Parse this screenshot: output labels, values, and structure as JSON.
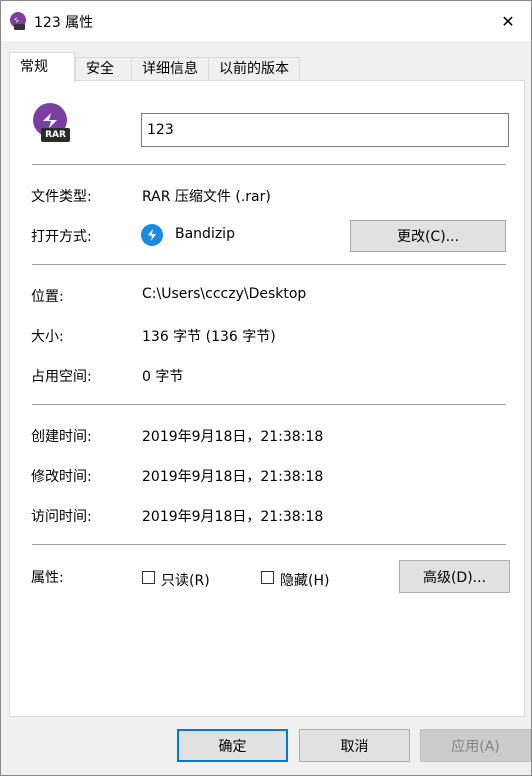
{
  "window": {
    "title": "123 属性",
    "close_glyph": "✕"
  },
  "tabs": [
    {
      "label": "常规",
      "active": true
    },
    {
      "label": "安全",
      "active": false
    },
    {
      "label": "详细信息",
      "active": false
    },
    {
      "label": "以前的版本",
      "active": false
    }
  ],
  "file": {
    "icon_text": "RAR",
    "name": "123"
  },
  "type": {
    "label": "文件类型:",
    "value": "RAR 压缩文件 (.rar)"
  },
  "opens_with": {
    "label": "打开方式:",
    "app": "Bandizip",
    "change_button": "更改(C)..."
  },
  "location": {
    "label": "位置:",
    "value": "C:\\Users\\ccczy\\Desktop"
  },
  "size": {
    "label": "大小:",
    "value": "136 字节 (136 字节)"
  },
  "size_on_disk": {
    "label": "占用空间:",
    "value": "0 字节"
  },
  "created": {
    "label": "创建时间:",
    "value": "2019年9月18日，21:38:18"
  },
  "modified": {
    "label": "修改时间:",
    "value": "2019年9月18日，21:38:18"
  },
  "accessed": {
    "label": "访问时间:",
    "value": "2019年9月18日，21:38:18"
  },
  "attributes": {
    "label": "属性:",
    "readonly_label": "只读(R)",
    "readonly_checked": false,
    "hidden_label": "隐藏(H)",
    "hidden_checked": false,
    "advanced_button": "高级(D)..."
  },
  "footer": {
    "ok": "确定",
    "cancel": "取消",
    "apply": "应用(A)"
  },
  "colors": {
    "rar_icon_purple": "#7b3fa0",
    "bandizip_blue": "#1e88e5",
    "primary_border": "#0078d7"
  }
}
